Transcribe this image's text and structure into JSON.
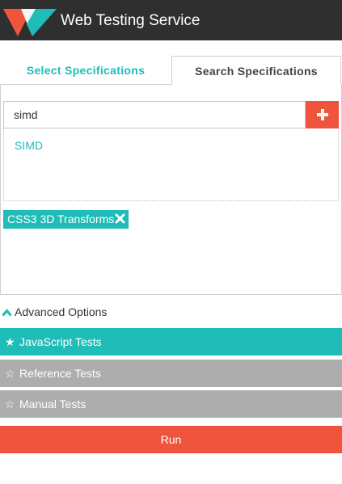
{
  "header": {
    "title": "Web Testing Service",
    "logo_icon": "wts-logo-icon"
  },
  "tabs": [
    {
      "label": "Select Specifications",
      "active": false
    },
    {
      "label": "Search Specifications",
      "active": true
    }
  ],
  "search": {
    "value": "simd",
    "add_icon": "plus-icon"
  },
  "results": [
    "SIMD"
  ],
  "selected": [
    {
      "label": "CSS3 3D Transforms",
      "remove_icon": "close-x-icon"
    }
  ],
  "advanced": {
    "label": "Advanced Options",
    "icon": "chevron-up-icon"
  },
  "options": [
    {
      "label": "JavaScript Tests",
      "icon": "star-filled-icon",
      "selected": true
    },
    {
      "label": "Reference Tests",
      "icon": "star-outline-icon",
      "selected": false
    },
    {
      "label": "Manual Tests",
      "icon": "star-outline-icon",
      "selected": false
    }
  ],
  "run_label": "Run",
  "colors": {
    "header": "#2f2f2f",
    "accent": "#1fbcb8",
    "danger": "#ee553c",
    "muted": "#adadad"
  }
}
